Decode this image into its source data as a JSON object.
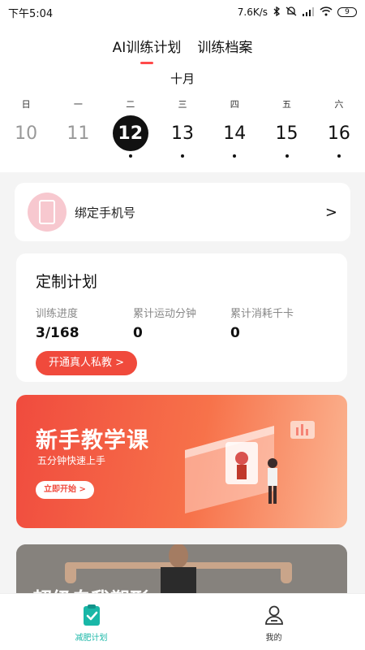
{
  "status_bar": {
    "time": "下午5:04",
    "net_speed": "7.6K/s",
    "battery": "9"
  },
  "tabs": [
    {
      "label": "AI训练计划",
      "active": true
    },
    {
      "label": "训练档案",
      "active": false
    }
  ],
  "calendar": {
    "month": "十月",
    "weekdays": [
      "日",
      "一",
      "二",
      "三",
      "四",
      "五",
      "六"
    ],
    "dates": [
      {
        "day": "10",
        "state": "past",
        "dot": false
      },
      {
        "day": "11",
        "state": "past",
        "dot": false
      },
      {
        "day": "12",
        "state": "today",
        "dot": true
      },
      {
        "day": "13",
        "state": "future",
        "dot": true
      },
      {
        "day": "14",
        "state": "future",
        "dot": true
      },
      {
        "day": "15",
        "state": "future",
        "dot": true
      },
      {
        "day": "16",
        "state": "future",
        "dot": true
      }
    ]
  },
  "bind_phone": {
    "label": "绑定手机号",
    "chevron": ">",
    "icon": "phone-icon"
  },
  "plan": {
    "title": "定制计划",
    "stats": [
      {
        "label": "训练进度",
        "value": "3/168"
      },
      {
        "label": "累计运动分钟",
        "value": "0"
      },
      {
        "label": "累计消耗千卡",
        "value": "0"
      }
    ],
    "coach_button": "开通真人私教 >"
  },
  "banner": {
    "title": "新手教学课",
    "subtitle": "五分钟快速上手",
    "button": "立即开始 >"
  },
  "photo_card": {
    "title": "超级自我塑形"
  },
  "nav": [
    {
      "label": "减肥计划",
      "icon": "clipboard-check-icon",
      "active": true
    },
    {
      "label": "我的",
      "icon": "user-icon",
      "active": false
    }
  ],
  "colors": {
    "accent": "#f04a3c",
    "teal": "#19b7a7",
    "banner_start": "#f04b3e",
    "banner_end": "#fbb592"
  }
}
